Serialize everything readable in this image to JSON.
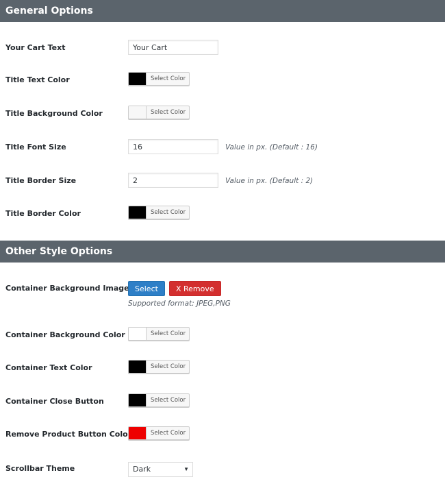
{
  "general": {
    "header": "General Options",
    "cart_text_label": "Your Cart Text",
    "cart_text_value": "Your Cart",
    "title_text_color_label": "Title Text Color",
    "title_text_color": "#000000",
    "title_bg_color_label": "Title Background Color",
    "title_bg_color": "#f7f7f7",
    "title_font_size_label": "Title Font Size",
    "title_font_size_value": "16",
    "title_font_size_hint": "Value in px. (Default : 16)",
    "title_border_size_label": "Title Border Size",
    "title_border_size_value": "2",
    "title_border_size_hint": "Value in px. (Default : 2)",
    "title_border_color_label": "Title Border Color",
    "title_border_color": "#000000"
  },
  "other": {
    "header": "Other Style Options",
    "bg_image_label": "Container Background Image",
    "select_button": "Select",
    "remove_button": "X Remove",
    "supported_format": "Supported format: JPEG,PNG",
    "container_bg_color_label": "Container Background Color",
    "container_bg_color": "#ffffff",
    "container_text_color_label": "Container Text Color",
    "container_text_color": "#000000",
    "close_button_label": "Container Close Button",
    "close_button_color": "#000000",
    "remove_product_label": "Remove Product Button Color",
    "remove_product_color": "#ee0000",
    "scrollbar_theme_label": "Scrollbar Theme",
    "scrollbar_theme_value": "Dark"
  },
  "color_picker_label": "Select Color"
}
